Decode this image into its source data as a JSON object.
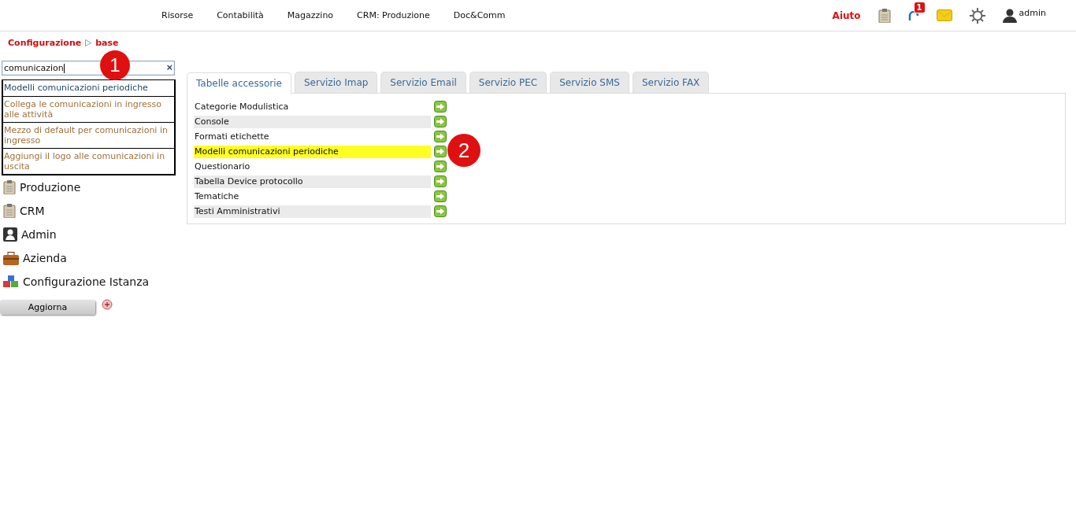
{
  "top_menu": [
    "Risorse",
    "Contabilità",
    "Magazzino",
    "CRM: Produzione",
    "Doc&Comm"
  ],
  "top_right": {
    "help": "Aiuto",
    "notification_count": "1",
    "user": "admin"
  },
  "breadcrumb": [
    "Configurazione",
    "base"
  ],
  "search": {
    "value": "comunicazion",
    "clear": "×"
  },
  "suggestions": [
    {
      "text": "Modelli comunicazioni periodiche",
      "selected": true
    },
    {
      "text": "Collega le comunicazioni in ingresso alle attività",
      "selected": false
    },
    {
      "text": "Mezzo di default per comunicazioni in ingresso",
      "selected": false
    },
    {
      "text": "Aggiungi il logo alle comunicazioni in uscita",
      "selected": false
    }
  ],
  "sidebar": {
    "items": [
      {
        "label": "Produzione",
        "kind": "clipboard"
      },
      {
        "label": "CRM",
        "kind": "clipboard"
      },
      {
        "label": "Admin",
        "kind": "user"
      },
      {
        "label": "Azienda",
        "kind": "briefcase"
      },
      {
        "label": "Configurazione Istanza",
        "kind": "blocks"
      }
    ],
    "button": "Aggiorna"
  },
  "tabs": [
    {
      "label": "Tabelle accessorie",
      "selected": true
    },
    {
      "label": "Servizio Imap",
      "selected": false
    },
    {
      "label": "Servizio Email",
      "selected": false
    },
    {
      "label": "Servizio PEC",
      "selected": false
    },
    {
      "label": "Servizio SMS",
      "selected": false
    },
    {
      "label": "Servizio FAX",
      "selected": false
    }
  ],
  "rows": [
    {
      "label": "Categorie Modulistica",
      "highlighted": false
    },
    {
      "label": "Console",
      "highlighted": false
    },
    {
      "label": "Formati etichette",
      "highlighted": false
    },
    {
      "label": "Modelli comunicazioni periodiche",
      "highlighted": true
    },
    {
      "label": "Questionario",
      "highlighted": false
    },
    {
      "label": "Tabella Device protocollo",
      "highlighted": false
    },
    {
      "label": "Tematiche",
      "highlighted": false
    },
    {
      "label": "Testi Amministrativi",
      "highlighted": false
    }
  ],
  "callouts": [
    "1",
    "2"
  ]
}
